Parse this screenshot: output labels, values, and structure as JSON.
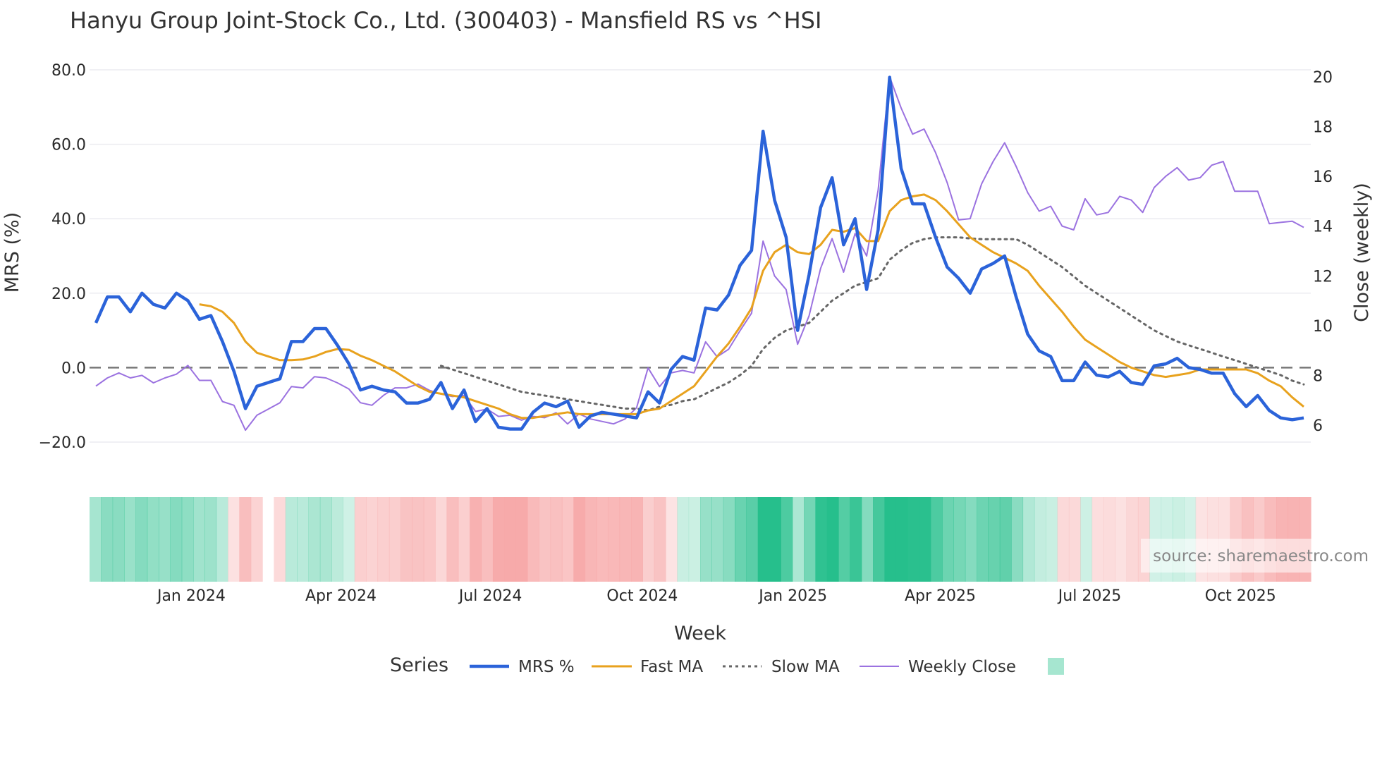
{
  "chart_data": {
    "type": "line",
    "title": "Hanyu Group Joint-Stock Co., Ltd. (300403) - Mansfield RS vs ^HSI",
    "xlabel": "Week",
    "ylabel": "MRS (%)",
    "y2label": "Close (weekly)",
    "ylim": [
      -25,
      85
    ],
    "y2lim": [
      5,
      20.6
    ],
    "yticks": [
      "80.0",
      "60.0",
      "40.0",
      "20.0",
      "0.0",
      "−20.0"
    ],
    "ytick_values": [
      80,
      60,
      40,
      20,
      0,
      -20
    ],
    "y2ticks": [
      "20",
      "18",
      "16",
      "14",
      "12",
      "10",
      "8",
      "6"
    ],
    "y2tick_values": [
      20,
      18,
      16,
      14,
      12,
      10,
      8,
      6
    ],
    "xticks": [
      "Jan 2024",
      "Apr 2024",
      "Jul 2024",
      "Oct 2024",
      "Jan 2025",
      "Apr 2025",
      "Jul 2025",
      "Oct 2025"
    ],
    "xtick_week_index": [
      8.3,
      21.3,
      34.3,
      47.5,
      60.6,
      73.4,
      86.4,
      99.5
    ],
    "grid": true,
    "zero_line": "dashed",
    "legend_title": "Series",
    "legend_position": "bottom",
    "source": "source: sharemaestro.com",
    "n_weeks": 106,
    "series": [
      {
        "name": "MRS %",
        "color": "#2b63d9",
        "axis": "left",
        "start": 0,
        "values": [
          12,
          19,
          19,
          15,
          20,
          17,
          16,
          20,
          18,
          13,
          14,
          7,
          -1,
          -11,
          -5,
          -4,
          -3,
          7,
          7,
          10.5,
          10.5,
          6,
          1,
          -6,
          -5,
          -6,
          -6.5,
          -9.5,
          -9.5,
          -8.5,
          -4,
          -11,
          -6,
          -14.5,
          -11,
          -16,
          -16.5,
          -16.5,
          -12,
          -9.5,
          -10.5,
          -9,
          -16,
          -13,
          -12,
          -12.5,
          -13,
          -13.5,
          -6.5,
          -9.5,
          -0.5,
          3,
          2,
          16,
          15.5,
          19.5,
          27.5,
          31.5,
          63.5,
          45,
          35,
          10,
          25,
          43,
          51,
          33,
          40,
          21,
          37,
          78,
          53.5,
          44,
          44,
          35,
          27,
          24,
          20,
          26.5,
          28,
          30,
          19,
          9,
          4.5,
          3,
          -3.5,
          -3.5,
          1.5,
          -2,
          -2.5,
          -1,
          -4,
          -4.5,
          0.5,
          1,
          2.5,
          0,
          -0.5,
          -1.5,
          -1.5,
          -7,
          -10.5,
          -7.5,
          -11.5,
          -13.5,
          -14,
          -13.5
        ]
      },
      {
        "name": "Fast MA",
        "color": "#e8a21e",
        "axis": "left",
        "start": 9,
        "values": [
          17,
          16.5,
          15,
          12,
          7,
          4,
          3,
          2,
          2,
          2.2,
          3,
          4.2,
          5,
          4.8,
          3.2,
          2,
          0.5,
          -1,
          -3,
          -5,
          -6.5,
          -7,
          -7.5,
          -8,
          -9,
          -10,
          -11,
          -12.5,
          -13.5,
          -13.5,
          -13,
          -12.5,
          -12,
          -12.5,
          -12.5,
          -12.5,
          -12.5,
          -12.5,
          -12.5,
          -11.5,
          -11,
          -9,
          -7,
          -5,
          -1,
          3,
          6.5,
          11,
          16,
          26,
          31,
          33,
          31,
          30.5,
          33,
          37,
          36.5,
          37.5,
          34,
          34,
          42,
          45,
          46,
          46.5,
          45,
          42,
          38.5,
          35,
          33,
          31,
          29.5,
          28,
          26,
          22,
          18.5,
          15,
          11,
          7.5,
          5.5,
          3.5,
          1.5,
          0,
          -1,
          -2,
          -2.5,
          -2,
          -1.5,
          -0.5,
          -0.5,
          -0.5,
          -0.5,
          -0.5,
          -1.5,
          -3.5,
          -5,
          -8,
          -10.5
        ]
      },
      {
        "name": "Slow MA",
        "color": "#666666",
        "axis": "left",
        "start": 30,
        "dash": "dot",
        "values": [
          0.5,
          -0.5,
          -1.5,
          -2.5,
          -3.5,
          -4.5,
          -5.5,
          -6.5,
          -7,
          -7.5,
          -8,
          -8.5,
          -9,
          -9.5,
          -10,
          -10.5,
          -11,
          -11,
          -11.5,
          -10.5,
          -10,
          -9,
          -8.5,
          -7,
          -5.5,
          -4,
          -2,
          0.5,
          5,
          8,
          10,
          11,
          12,
          15,
          18,
          20,
          22,
          23,
          24,
          29,
          31.5,
          33.5,
          34.5,
          35,
          35,
          35,
          34.7,
          34.5,
          34.5,
          34.5,
          34.5,
          33,
          31,
          29,
          27,
          24.5,
          22,
          20,
          18,
          16,
          14,
          12,
          10,
          8.5,
          7,
          6,
          5,
          4,
          3,
          2,
          1,
          0,
          -1,
          -2,
          -3.5,
          -4.5
        ]
      },
      {
        "name": "Weekly Close",
        "color": "#9b72e0",
        "axis": "right",
        "start": 0,
        "values": [
          7.57,
          7.9,
          8.1,
          7.9,
          8.0,
          7.7,
          7.9,
          8.05,
          8.4,
          7.8,
          7.8,
          6.95,
          6.8,
          5.8,
          6.4,
          6.65,
          6.9,
          7.55,
          7.5,
          7.95,
          7.9,
          7.7,
          7.45,
          6.9,
          6.8,
          7.2,
          7.5,
          7.5,
          7.65,
          7.4,
          7.25,
          7.15,
          7.2,
          6.55,
          6.65,
          6.35,
          6.4,
          6.2,
          6.35,
          6.3,
          6.5,
          6.05,
          6.45,
          6.25,
          6.15,
          6.05,
          6.25,
          6.7,
          8.3,
          7.55,
          8.1,
          8.2,
          8.1,
          9.35,
          8.75,
          9.05,
          9.8,
          10.5,
          13.4,
          12.0,
          11.45,
          9.25,
          10.4,
          12.3,
          13.5,
          12.15,
          13.7,
          12.8,
          15.45,
          20.0,
          18.75,
          17.7,
          17.9,
          16.95,
          15.75,
          14.25,
          14.3,
          15.7,
          16.6,
          17.35,
          16.4,
          15.35,
          14.6,
          14.8,
          14.0,
          13.85,
          15.1,
          14.45,
          14.55,
          15.2,
          15.05,
          14.55,
          15.55,
          16.0,
          16.35,
          15.85,
          15.95,
          16.45,
          16.6,
          15.4,
          15.4,
          15.4,
          14.1,
          14.15,
          14.2,
          13.95
        ]
      }
    ],
    "heatmap": {
      "based_on": "MRS %",
      "missing_week_index": [
        15
      ],
      "positive_color": "#26bf8c",
      "negative_color": "#f7a8a8"
    }
  }
}
